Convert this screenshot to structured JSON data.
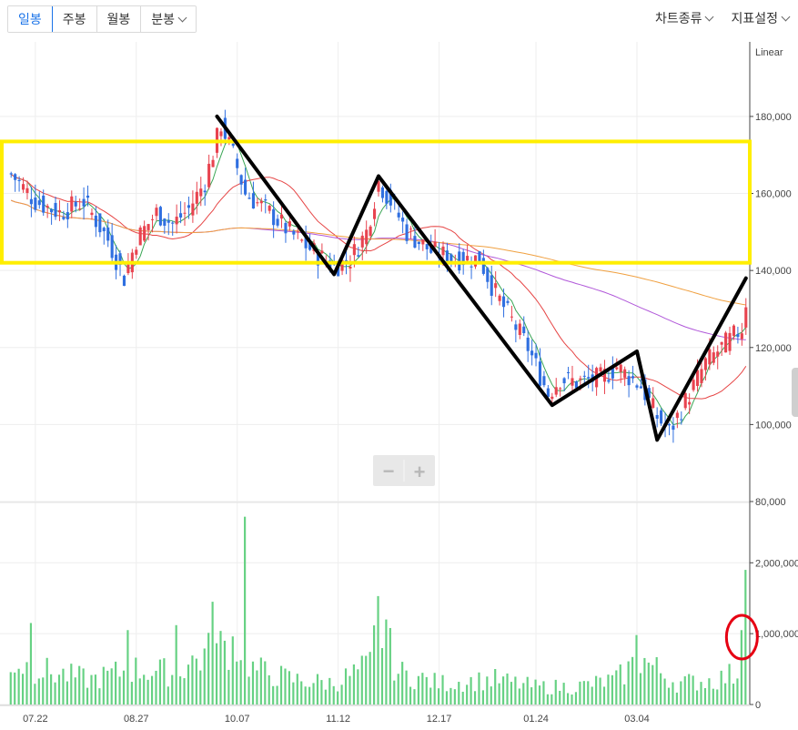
{
  "toolbar": {
    "periods": [
      {
        "label": "일봉",
        "active": true
      },
      {
        "label": "주봉",
        "active": false
      },
      {
        "label": "월봉",
        "active": false
      },
      {
        "label": "분봉",
        "active": false
      }
    ],
    "chart_type_label": "차트종류",
    "indicator_label": "지표설정"
  },
  "zoom": {
    "minus": "−",
    "plus": "+"
  },
  "chart_data": {
    "type": "candlestick",
    "scale_label": "Linear",
    "price_axis": {
      "ticks": [
        180000,
        160000,
        140000,
        120000,
        100000,
        80000
      ],
      "tick_labels": [
        "180,000",
        "160,000",
        "140,000",
        "120,000",
        "100,000",
        "80,000"
      ],
      "ylim": [
        80000,
        197000
      ]
    },
    "volume_axis": {
      "ticks": [
        2000000,
        1000000,
        0
      ],
      "tick_labels": [
        "2,000,000",
        "1,000,000",
        "0"
      ],
      "ylim": [
        0,
        2800000
      ]
    },
    "x_tick_labels": [
      "07.22",
      "08.27",
      "10.07",
      "11.12",
      "12.17",
      "01.24",
      "03.04"
    ],
    "candle_count": 183,
    "x_tick_candle_index": [
      6,
      31,
      56,
      81,
      106,
      130,
      155
    ],
    "price_keypoints": [
      [
        0,
        165000
      ],
      [
        6,
        158000
      ],
      [
        12,
        155000
      ],
      [
        18,
        158000
      ],
      [
        24,
        148000
      ],
      [
        28,
        138000
      ],
      [
        31,
        148000
      ],
      [
        36,
        155000
      ],
      [
        40,
        152000
      ],
      [
        44,
        156000
      ],
      [
        48,
        163000
      ],
      [
        52,
        178000
      ],
      [
        55,
        170000
      ],
      [
        58,
        160000
      ],
      [
        64,
        155000
      ],
      [
        70,
        149000
      ],
      [
        76,
        144000
      ],
      [
        80,
        141000
      ],
      [
        84,
        143000
      ],
      [
        88,
        150000
      ],
      [
        91,
        163000
      ],
      [
        94,
        158000
      ],
      [
        98,
        150000
      ],
      [
        104,
        145000
      ],
      [
        110,
        143000
      ],
      [
        116,
        143000
      ],
      [
        120,
        134000
      ],
      [
        124,
        127000
      ],
      [
        128,
        120000
      ],
      [
        133,
        108000
      ],
      [
        136,
        112000
      ],
      [
        140,
        111000
      ],
      [
        146,
        112000
      ],
      [
        150,
        115000
      ],
      [
        156,
        110000
      ],
      [
        160,
        102000
      ],
      [
        163,
        98000
      ],
      [
        167,
        106000
      ],
      [
        172,
        116000
      ],
      [
        177,
        121000
      ],
      [
        181,
        125000
      ],
      [
        182,
        132000
      ]
    ],
    "volume_keypoints": [
      [
        0,
        600000
      ],
      [
        10,
        450000
      ],
      [
        20,
        350000
      ],
      [
        30,
        500000
      ],
      [
        40,
        450000
      ],
      [
        48,
        700000
      ],
      [
        56,
        900000
      ],
      [
        60,
        500000
      ],
      [
        70,
        350000
      ],
      [
        80,
        300000
      ],
      [
        89,
        550000
      ],
      [
        91,
        1200000
      ],
      [
        96,
        450000
      ],
      [
        106,
        300000
      ],
      [
        120,
        350000
      ],
      [
        130,
        250000
      ],
      [
        140,
        250000
      ],
      [
        150,
        350000
      ],
      [
        156,
        650000
      ],
      [
        165,
        300000
      ],
      [
        175,
        350000
      ],
      [
        180,
        450000
      ],
      [
        182,
        1500000
      ]
    ],
    "volume_spikes": [
      {
        "i": 5,
        "v": 1150000
      },
      {
        "i": 29,
        "v": 1050000
      },
      {
        "i": 41,
        "v": 1120000
      },
      {
        "i": 50,
        "v": 1450000
      },
      {
        "i": 58,
        "v": 2650000
      },
      {
        "i": 53,
        "v": 900000
      },
      {
        "i": 91,
        "v": 1530000
      },
      {
        "i": 93,
        "v": 1200000
      },
      {
        "i": 155,
        "v": 980000
      },
      {
        "i": 182,
        "v": 1900000
      },
      {
        "i": 181,
        "v": 1050000
      }
    ],
    "moving_averages": [
      {
        "period": 5,
        "color": "#3aa655"
      },
      {
        "period": 20,
        "color": "#e64545"
      },
      {
        "period": 60,
        "color": "#b057d9"
      },
      {
        "period": 120,
        "color": "#f0a040"
      }
    ],
    "colors": {
      "up": "#e8434f",
      "down": "#2f6fe0",
      "volume": "#66d183",
      "grid": "#eeeeee",
      "axis": "#444444"
    }
  },
  "annotations": {
    "resistance_box": {
      "price_top": 173500,
      "price_bottom": 142000,
      "color": "#ffee00"
    },
    "zigzag": {
      "color": "#000000",
      "points": [
        [
          51,
          180000
        ],
        [
          80,
          139000
        ],
        [
          91,
          164500
        ],
        [
          134,
          105000
        ],
        [
          155,
          119000
        ],
        [
          160,
          96000
        ],
        [
          182,
          138000
        ]
      ]
    },
    "volume_circle": {
      "candle_index": 181,
      "volume": 950000,
      "color": "#e60012"
    }
  }
}
